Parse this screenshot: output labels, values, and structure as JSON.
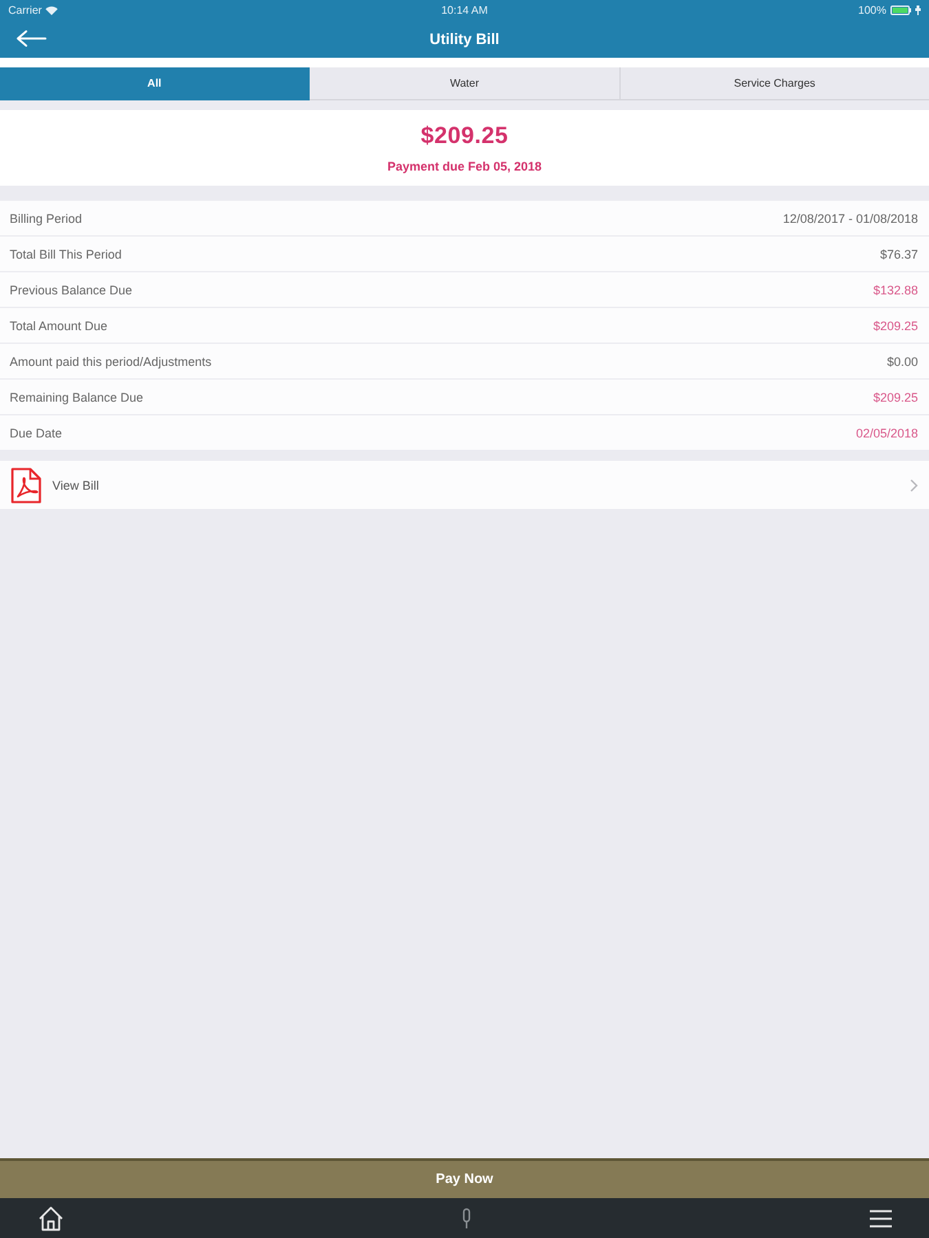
{
  "status_bar": {
    "carrier": "Carrier",
    "time": "10:14 AM",
    "battery": "100%"
  },
  "header": {
    "title": "Utility Bill"
  },
  "tabs": [
    {
      "label": "All",
      "selected": true
    },
    {
      "label": "Water",
      "selected": false
    },
    {
      "label": "Service Charges",
      "selected": false
    }
  ],
  "summary": {
    "amount": "$209.25",
    "due_text": "Payment due Feb 05, 2018"
  },
  "details": [
    {
      "label": "Billing Period",
      "value": "12/08/2017 - 01/08/2018",
      "highlighted": false
    },
    {
      "label": "Total Bill This Period",
      "value": "$76.37",
      "highlighted": false
    },
    {
      "label": "Previous Balance Due",
      "value": "$132.88",
      "highlighted": true
    },
    {
      "label": "Total Amount Due",
      "value": "$209.25",
      "highlighted": true
    },
    {
      "label": "Amount paid this period/Adjustments",
      "value": "$0.00",
      "highlighted": false
    },
    {
      "label": "Remaining Balance Due",
      "value": "$209.25",
      "highlighted": true
    },
    {
      "label": "Due Date",
      "value": "02/05/2018",
      "highlighted": true
    }
  ],
  "view_bill": {
    "label": "View Bill"
  },
  "pay_button": {
    "label": "Pay Now"
  }
}
